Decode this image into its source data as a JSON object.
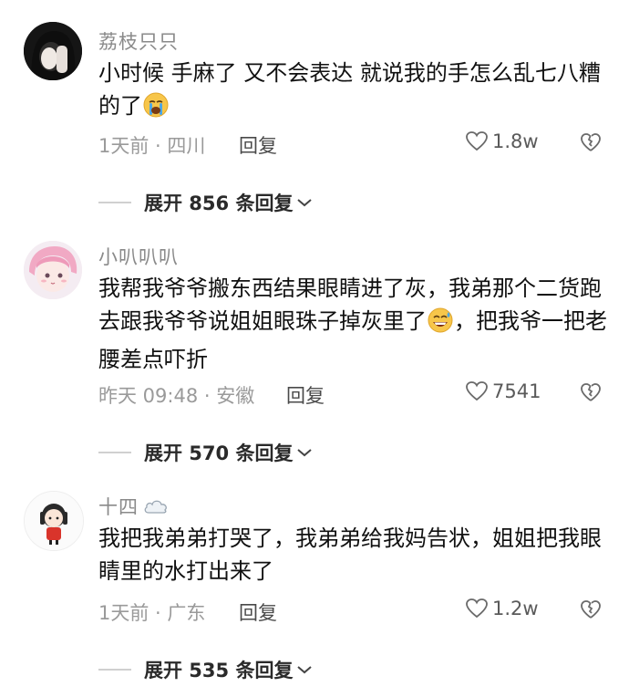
{
  "comments": [
    {
      "name": "荔枝只只",
      "text_a": "小时候 手麻了 又不会表达 就说我的手怎么乱七八糟的了",
      "emoji_a": "crying-face",
      "text_b": "",
      "time_location": "1天前 · 四川",
      "reply_label": "回复",
      "likes": "1.8w",
      "expand_label": "展开 856 条回复"
    },
    {
      "name": "小叭叭叭",
      "text_a": "我帮我爷爷搬东西结果眼睛进了灰，我弟那个二货跑去跟我爷爷说姐姐眼珠子掉灰里了",
      "emoji_a": "grinning-sweat-face",
      "text_b": "，把我爷一把老腰差点吓折",
      "time_location": "昨天 09:48 · 安徽",
      "reply_label": "回复",
      "likes": "7541",
      "expand_label": "展开 570 条回复"
    },
    {
      "name": "十四",
      "name_badge": "cloud-icon",
      "text_a": "我把我弟弟打哭了，我弟弟给我妈告状，姐姐把我眼睛里的水打出来了",
      "time_location": "1天前 · 广东",
      "reply_label": "回复",
      "likes": "1.2w",
      "expand_label": "展开 535 条回复"
    }
  ]
}
